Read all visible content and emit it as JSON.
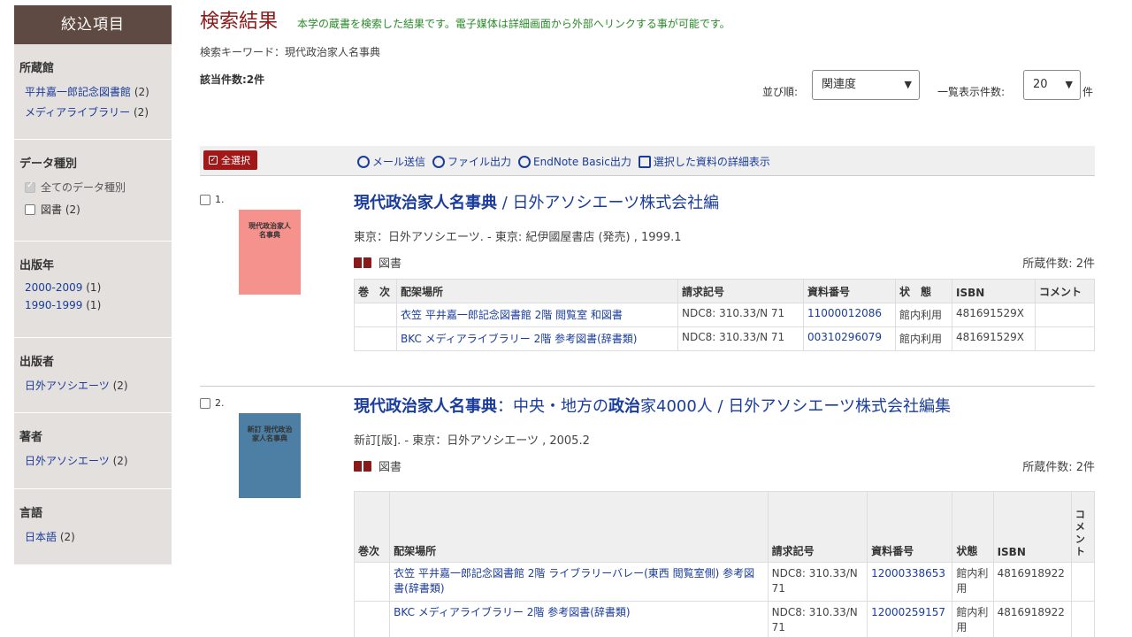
{
  "sidebar": {
    "header": "絞込項目",
    "sections": [
      {
        "title": "所蔵館",
        "items": [
          {
            "label": "平井嘉一郎記念図書館",
            "count": "(2)"
          },
          {
            "label": "メディアライブラリー",
            "count": "(2)"
          }
        ]
      },
      {
        "title": "データ種別",
        "checks": [
          {
            "label": "全てのデータ種別",
            "disabled": true
          },
          {
            "label": "図書",
            "count": "(2)"
          }
        ]
      },
      {
        "title": "出版年",
        "items": [
          {
            "label": "2000-2009",
            "count": "(1)"
          },
          {
            "label": "1990-1999",
            "count": "(1)"
          }
        ]
      },
      {
        "title": "出版者",
        "items": [
          {
            "label": "日外アソシエーツ",
            "count": "(2)"
          }
        ]
      },
      {
        "title": "著者",
        "items": [
          {
            "label": "日外アソシエーツ",
            "count": "(2)"
          }
        ]
      },
      {
        "title": "言語",
        "items": [
          {
            "label": "日本語",
            "count": "(2)"
          }
        ]
      }
    ]
  },
  "main": {
    "title": "検索結果",
    "description": "本学の蔵書を検索した結果です。電子媒体は詳細画面から外部へリンクする事が可能です。",
    "keyword": "検索キーワード：現代政治家人名事典",
    "hits": "該当件数:2件",
    "sort_label": "並び順:",
    "sort_value": "関連度",
    "per_page_label": "一覧表示件数:",
    "per_page_value": "20",
    "per_page_unit": "件"
  },
  "toolbar": {
    "select_all": "全選択",
    "tools": [
      "メール送信",
      "ファイル出力",
      "EndNote Basic出力",
      "選択した資料の詳細表示"
    ]
  },
  "records": [
    {
      "num": "1.",
      "cover_text": "現代政治家人名事典",
      "title_main": "現代政治家人名事典",
      "title_rest": " / 日外アソシエーツ株式会社編",
      "info": "東京：日外アソシエーツ. - 東京: 紀伊國屋書店 (発売) , 1999.1",
      "type": "図書",
      "count": "所蔵件数: 2件",
      "headers": [
        "巻　次",
        "配架場所",
        "請求記号",
        "資料番号",
        "状　態",
        "ISBN",
        "コメント"
      ],
      "rows": [
        [
          "",
          "衣笠 平井嘉一郎記念図書館 2階 閲覧室 和図書",
          "NDC8: 310.33/N 71",
          "11000012086",
          "館内利用",
          "481691529X",
          ""
        ],
        [
          "",
          "BKC メディアライブラリー 2階 参考図書(辞書類)",
          "NDC8: 310.33/N 71",
          "00310296079",
          "館内利用",
          "481691529X",
          ""
        ]
      ]
    },
    {
      "num": "2.",
      "cover_text": "新訂 現代政治家人名事典",
      "title_main": "現代政治家人名事典",
      "title_rest": "：中央・地方の",
      "title_bold2": "政治",
      "title_rest2": "家4000人 / 日外アソシエーツ株式会社編集",
      "info": "新訂[版]. - 東京：日外アソシエーツ , 2005.2",
      "type": "図書",
      "count": "所蔵件数: 2件",
      "headers": [
        "巻次",
        "配架場所",
        "請求記号",
        "資料番号",
        "状態",
        "ISBN",
        "コメント"
      ],
      "rows": [
        [
          "",
          "衣笠 平井嘉一郎記念図書館 2階 ライブラリーバレー(東西 閲覧室側) 参考図書(辞書類)",
          "NDC8: 310.33/N 71",
          "12000338653",
          "館内利用",
          "4816918922",
          ""
        ],
        [
          "",
          "BKC メディアライブラリー 2階 参考図書(辞書類)",
          "NDC8: 310.33/N 71",
          "12000259157",
          "館内利用",
          "4816918922",
          ""
        ]
      ]
    }
  ]
}
